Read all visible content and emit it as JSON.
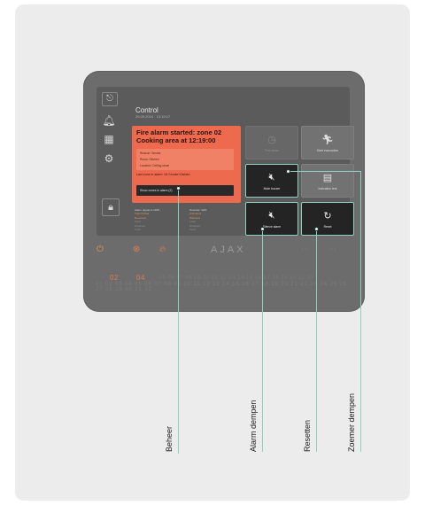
{
  "panel": {
    "title": "Control",
    "subtitle": "29.09.2024 · 13:19:17"
  },
  "alarm_card": {
    "title": "Fire alarm started: zone 02 Cooking area at 12:19:00",
    "details": [
      "Reason: Smoke",
      "Room: Kitchen",
      "Location: Ceiling stove"
    ],
    "last_zone": "Last zone in alarm: 04 Smoke Kitchen",
    "show_zones_button": "Show zones in alarm (2)"
  },
  "tiles": {
    "first_alarm": "First alarm",
    "start_evacuation": "Start evacuation",
    "mute_buzzer": "Mute buzzer",
    "indication_test": "Indication test",
    "silence_alarm": "Silence alarm",
    "reset": "Reset"
  },
  "status": {
    "left_heading": "Alarm signal to CMS",
    "left_lines": [
      "Transmitted",
      "Received",
      "Fault",
      "Disabled",
      "Fault"
    ],
    "right_heading": "Sounder, VAD",
    "right_lines": [
      "Activated",
      "Silenced",
      "Fault",
      "Disabled",
      "Fault"
    ]
  },
  "device": {
    "brand": "AJAX",
    "active_zones": [
      "02",
      "04"
    ],
    "zone_row_1": "05 06 07 08 09 10 11 12 13 14 15 16 17 18 19 20 21 22",
    "zone_row_2": "01 02 03 04 05 06 07 08 09 10 11 12 13 14 15 16 17 18 19 20 21 22 23 24 25 26 27 28 29 30 31 32"
  },
  "callouts": {
    "beheer": "Beheer",
    "alarm_dempen": "Alarm dempen",
    "resetten": "Resetten",
    "zoemer_dempen": "Zoemer dempen"
  },
  "colors": {
    "accent": "#8fcfbf",
    "alarm": "#ee6a4f",
    "zone_active": "#e2774f"
  },
  "icons": {
    "clock": "clock-icon",
    "evacuation": "running-person-icon",
    "mute": "speaker-mute-icon",
    "test": "indication-test-icon",
    "silence": "speaker-mute-icon",
    "reset": "reset-arrow-icon",
    "bell": "bell-icon",
    "grid": "grid-icon",
    "settings": "gear-icon",
    "lock": "lock-icon"
  }
}
